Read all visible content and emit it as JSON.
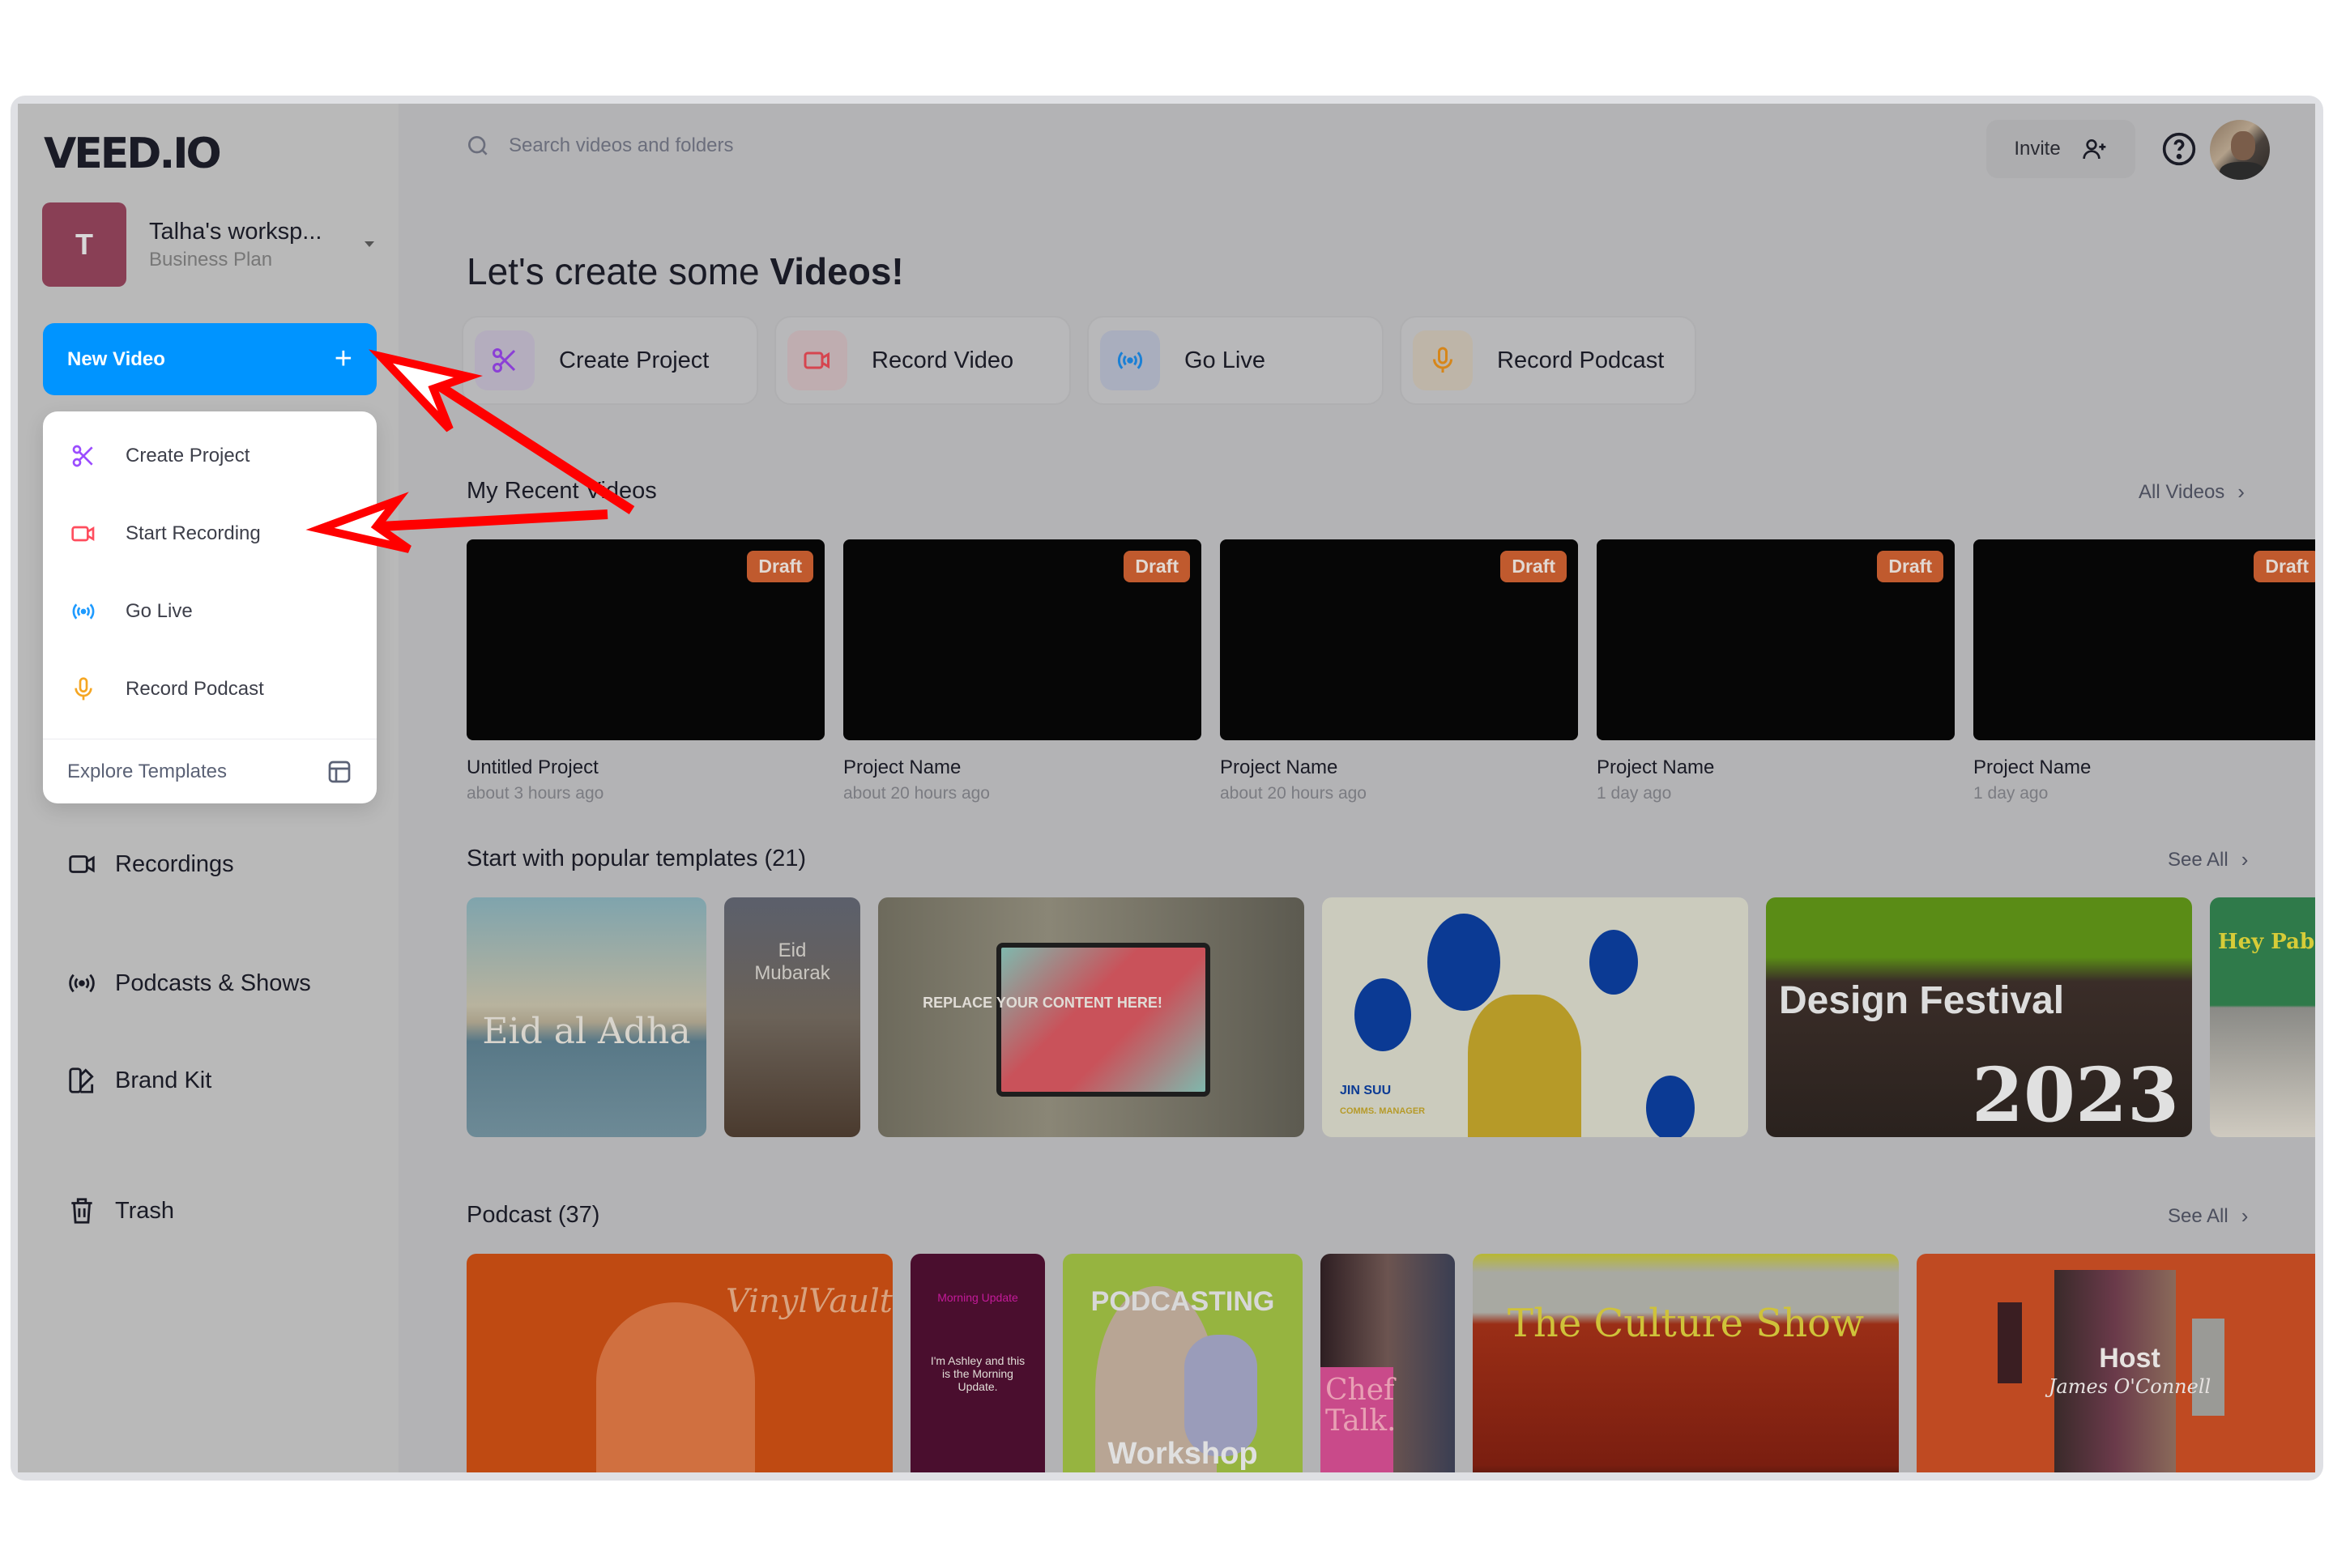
{
  "app": {
    "logo": "VEED.IO",
    "workspace": {
      "initial": "T",
      "name": "Talha's worksp...",
      "plan": "Business Plan"
    },
    "new_video": {
      "label": "New Video",
      "plus": "+"
    }
  },
  "new_video_menu": {
    "items": [
      {
        "label": "Create Project",
        "icon": "scissors-icon",
        "color": "#9b4dff"
      },
      {
        "label": "Start Recording",
        "icon": "video-camera-icon",
        "color": "#ff4d5e"
      },
      {
        "label": "Go Live",
        "icon": "broadcast-icon",
        "color": "#1f9bff"
      },
      {
        "label": "Record Podcast",
        "icon": "microphone-icon",
        "color": "#f5a623"
      }
    ],
    "footer": {
      "label": "Explore Templates",
      "icon": "template-icon"
    }
  },
  "sidebar": {
    "items": [
      {
        "label": "Recordings",
        "icon": "recordings-icon"
      },
      {
        "label": "Podcasts & Shows",
        "icon": "broadcast-icon"
      },
      {
        "label": "Brand Kit",
        "icon": "brand-kit-icon"
      },
      {
        "label": "Trash",
        "icon": "trash-icon"
      }
    ]
  },
  "topbar": {
    "search_placeholder": "Search videos and folders",
    "invite_label": "Invite",
    "help_icon": "question-circle-icon"
  },
  "hero": {
    "prefix": "Let's create some ",
    "bold": "Videos!",
    "actions": [
      {
        "label": "Create Project",
        "icon": "scissors-icon",
        "color": "#8b3fd6",
        "bg": "#b4adbe"
      },
      {
        "label": "Record Video",
        "icon": "video-camera-icon",
        "color": "#d6454f",
        "bg": "#bfadb0"
      },
      {
        "label": "Go Live",
        "icon": "broadcast-icon",
        "color": "#1a80d6",
        "bg": "#a9aebe"
      },
      {
        "label": "Record Podcast",
        "icon": "microphone-icon",
        "color": "#d6861a",
        "bg": "#beb5a8"
      }
    ]
  },
  "recent": {
    "title": "My Recent Videos",
    "link": "All Videos",
    "videos": [
      {
        "title": "Untitled Project",
        "time": "about 3 hours ago",
        "badge": "Draft"
      },
      {
        "title": "Project Name",
        "time": "about 20 hours ago",
        "badge": "Draft"
      },
      {
        "title": "Project Name",
        "time": "about 20 hours ago",
        "badge": "Draft"
      },
      {
        "title": "Project Name",
        "time": "1 day ago",
        "badge": "Draft"
      },
      {
        "title": "Project Name",
        "time": "1 day ago",
        "badge": "Draft"
      }
    ]
  },
  "templates": {
    "title": "Start with popular templates (21)",
    "link": "See All",
    "items": [
      {
        "text": "Eid al Adha"
      },
      {
        "text": "Eid Mubarak"
      },
      {
        "text": "REPLACE YOUR CONTENT HERE!"
      },
      {
        "text": "JIN SUU",
        "sub": "COMMS. MANAGER"
      },
      {
        "text": "Design Festival",
        "sub": "2023"
      },
      {
        "text": "Hey Pablo"
      }
    ]
  },
  "podcast": {
    "title": "Podcast (37)",
    "link": "See All",
    "items": [
      {
        "text": "VinylVaults"
      },
      {
        "text": "Morning Update",
        "sub": "I'm Ashley and this is the Morning Update."
      },
      {
        "text": "PODCASTING",
        "sub": "Workshop"
      },
      {
        "text": "Chef Talk."
      },
      {
        "text": "The Culture Show"
      },
      {
        "text": "Host",
        "sub": "James O'Connell"
      }
    ]
  },
  "annotations": {
    "arrow_color": "#ff0000",
    "arrow_count": 2
  }
}
